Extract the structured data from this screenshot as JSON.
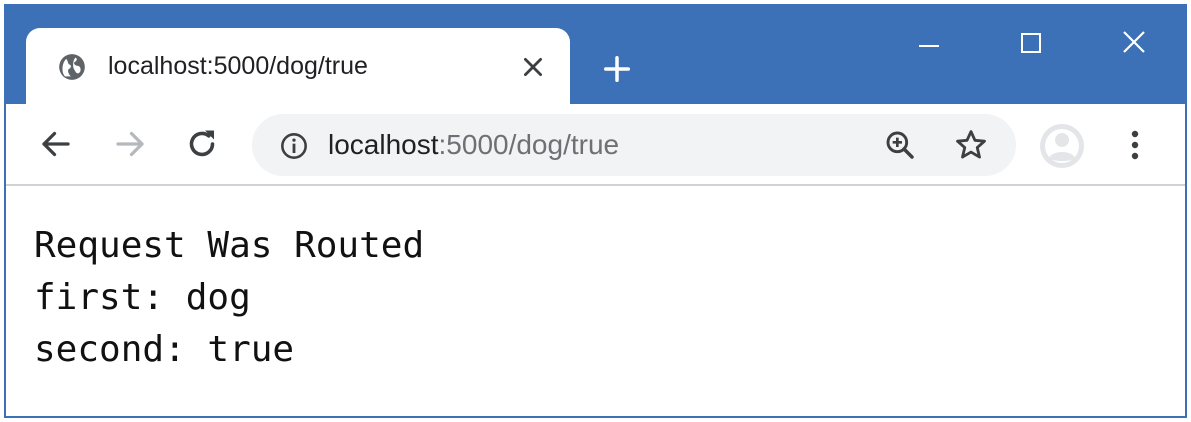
{
  "window": {
    "colors": {
      "titlebar": "#3c70b7",
      "toolbar": "#ffffff",
      "omnibox": "#f1f3f4",
      "url_dim": "#6d7176"
    },
    "controls": [
      "minimize-icon",
      "maximize-icon",
      "close-window-icon"
    ]
  },
  "tab": {
    "title": "localhost:5000/dog/true",
    "icon": "globe-icon",
    "close_icon": "close-icon"
  },
  "new_tab_icon": "plus-icon",
  "toolbar": {
    "back_icon": "back-arrow-icon",
    "forward_icon": "forward-arrow-icon",
    "reload_icon": "reload-icon",
    "menu_icon": "kebab-menu-icon",
    "avatar_icon": "profile-avatar-icon"
  },
  "omnibox": {
    "info_icon": "info-icon",
    "url_host": "localhost",
    "url_rest": ":5000/dog/true",
    "zoom_icon": "zoom-in-icon",
    "bookmark_icon": "star-icon"
  },
  "page": {
    "lines": [
      "Request Was Routed",
      "first: dog",
      "second: true"
    ]
  }
}
